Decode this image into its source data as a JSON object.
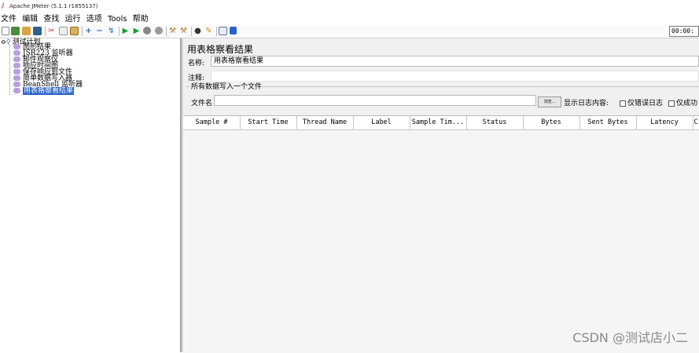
{
  "window": {
    "title": "Apache JMeter (5.1.1 r1855137)"
  },
  "menu": [
    "文件",
    "编辑",
    "查找",
    "运行",
    "选项",
    "Tools",
    "帮助"
  ],
  "toolbar": {
    "icons": [
      "new-icon",
      "templates-icon",
      "open-icon",
      "save-icon",
      "cut-icon",
      "copy-icon",
      "paste-icon",
      "expand-icon",
      "collapse-icon",
      "toggle-icon",
      "start-icon",
      "start-no-pause-icon",
      "stop-icon",
      "shutdown-icon",
      "clear-icon",
      "clear-all-icon",
      "search-icon",
      "reset-search-icon",
      "function-helper-icon",
      "help-icon"
    ],
    "timer": "00:00:"
  },
  "tree": {
    "root": "测试计划",
    "items": [
      "图形结果",
      "JSR223 监听器",
      "邮件观察仪",
      "响应时间图",
      "保存响应到文件",
      "简单数据写入器",
      "BeanShell 监听器",
      "用表格察看结果"
    ],
    "selected_index": 7
  },
  "panel": {
    "title": "用表格察看结果",
    "name_label": "名称:",
    "name_value": "用表格察看结果",
    "comment_label": "注释:",
    "comment_value": "",
    "file_group_label": "所有数据写入一个文件",
    "filename_label": "文件名",
    "filename_value": "",
    "browse_label": "浏览...",
    "log_content_label": "显示日志内容:",
    "errors_only_label": "仅错误日志",
    "success_only_label": "仅成功"
  },
  "table": {
    "columns": [
      "Sample #",
      "Start Time",
      "Thread Name",
      "Label",
      "Sample Tim...",
      "Status",
      "Bytes",
      "Sent Bytes",
      "Latency",
      "C"
    ]
  },
  "watermark": "CSDN @测试店小二"
}
